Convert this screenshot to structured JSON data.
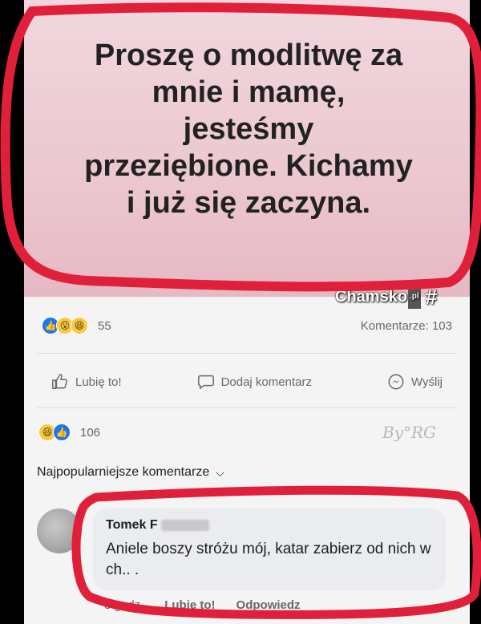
{
  "post": {
    "text": "Proszę o modlitwę za\nmnie i mamę,\njesteśmy\nprzeziębione. Kichamy\ni już się zaczyna."
  },
  "watermark": {
    "brand": "Chamsko",
    "tld": ".pl",
    "author": "By°RG"
  },
  "stats": {
    "reactions_count": "55",
    "comments_label": "Komentarze: 103",
    "reactions_count_2": "106"
  },
  "actions": {
    "like": "Lubię to!",
    "comment": "Dodaj komentarz",
    "share": "Wyślij"
  },
  "comments_section": {
    "sort_label": "Najpopularniejsze komentarze"
  },
  "comment": {
    "author": "Tomek F",
    "text": "Aniele boszy stróżu mój, katar zabierz od nich w ch.. .",
    "time": "3 godz.",
    "like": "Lubię to!",
    "reply": "Odpowiedz"
  },
  "colors": {
    "accent_blue": "#1877f2",
    "marker_red": "#e0203a",
    "post_bg": "#ecc9d1"
  },
  "icons": [
    "like-icon",
    "comment-icon",
    "messenger-icon",
    "chevron-down-icon",
    "hash-icon"
  ]
}
